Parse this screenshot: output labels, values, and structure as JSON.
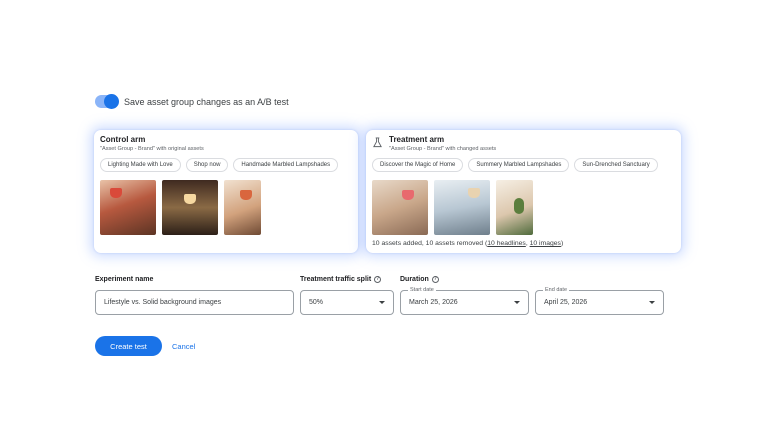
{
  "toggle": {
    "label": "Save asset group changes as an A/B test",
    "checked": true
  },
  "control": {
    "title": "Control arm",
    "subtitle": "\"Asset Group - Brand\" with original assets",
    "chips": [
      "Lighting Made with Love",
      "Shop now",
      "Handmade Marbled Lampshades"
    ]
  },
  "treatment": {
    "title": "Treatment arm",
    "subtitle": "\"Asset Group - Brand\" with changed assets",
    "chips": [
      "Discover the Magic of Home",
      "Summery Marbled Lampshades",
      "Sun-Drenched Sanctuary"
    ],
    "summary_prefix": "10 assets added, 10 assets removed (",
    "summary_headlines": "10 headlines",
    "summary_sep": ", ",
    "summary_images": "10 images",
    "summary_suffix": ")",
    "icon": "flask-icon"
  },
  "form": {
    "experiment_name_label": "Experiment name",
    "experiment_name_value": "Lifestyle vs. Solid background images",
    "traffic_label": "Treatment traffic split",
    "traffic_value": "50%",
    "duration_label": "Duration",
    "start_date_label": "Start date",
    "start_date_value": "March 25, 2026",
    "end_date_label": "End date",
    "end_date_value": "April 25, 2026"
  },
  "actions": {
    "create": "Create test",
    "cancel": "Cancel"
  },
  "colors": {
    "accent": "#1a73e8",
    "toggle_track": "#8ab4f8"
  }
}
